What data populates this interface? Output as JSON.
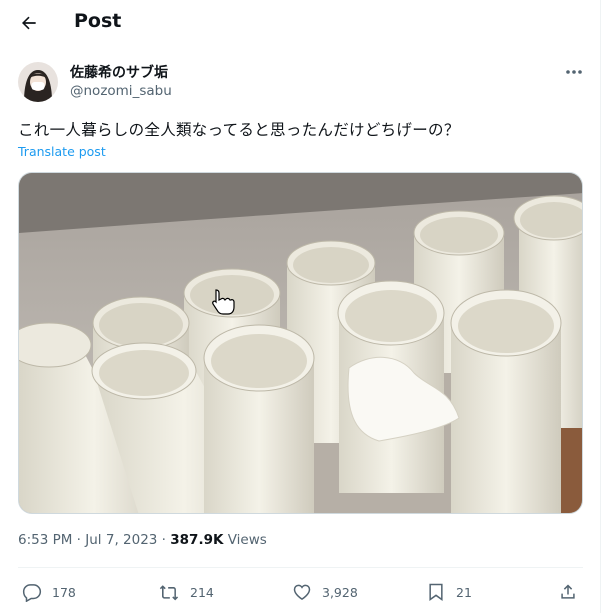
{
  "header": {
    "title": "Post",
    "back_icon": "arrow-left-icon"
  },
  "author": {
    "display_name": "佐藤希のサブ垢",
    "handle": "@nozomi_sabu"
  },
  "tweet": {
    "text": "これ一人暮らしの全人類なってると思ったんだけどちげーの？",
    "translate_label": "Translate post",
    "image_alt_icon": "photo-of-empty-toilet-paper-rolls"
  },
  "meta": {
    "time": "6:53 PM · Jul 7, 2023 · ",
    "views_count": "387.9K",
    "views_label": " Views"
  },
  "actions": {
    "replies": "178",
    "reposts": "214",
    "likes": "3,928",
    "bookmarks": "21"
  },
  "colors": {
    "link": "#1d9bf0",
    "muted": "#536471",
    "text": "#0f1419"
  }
}
